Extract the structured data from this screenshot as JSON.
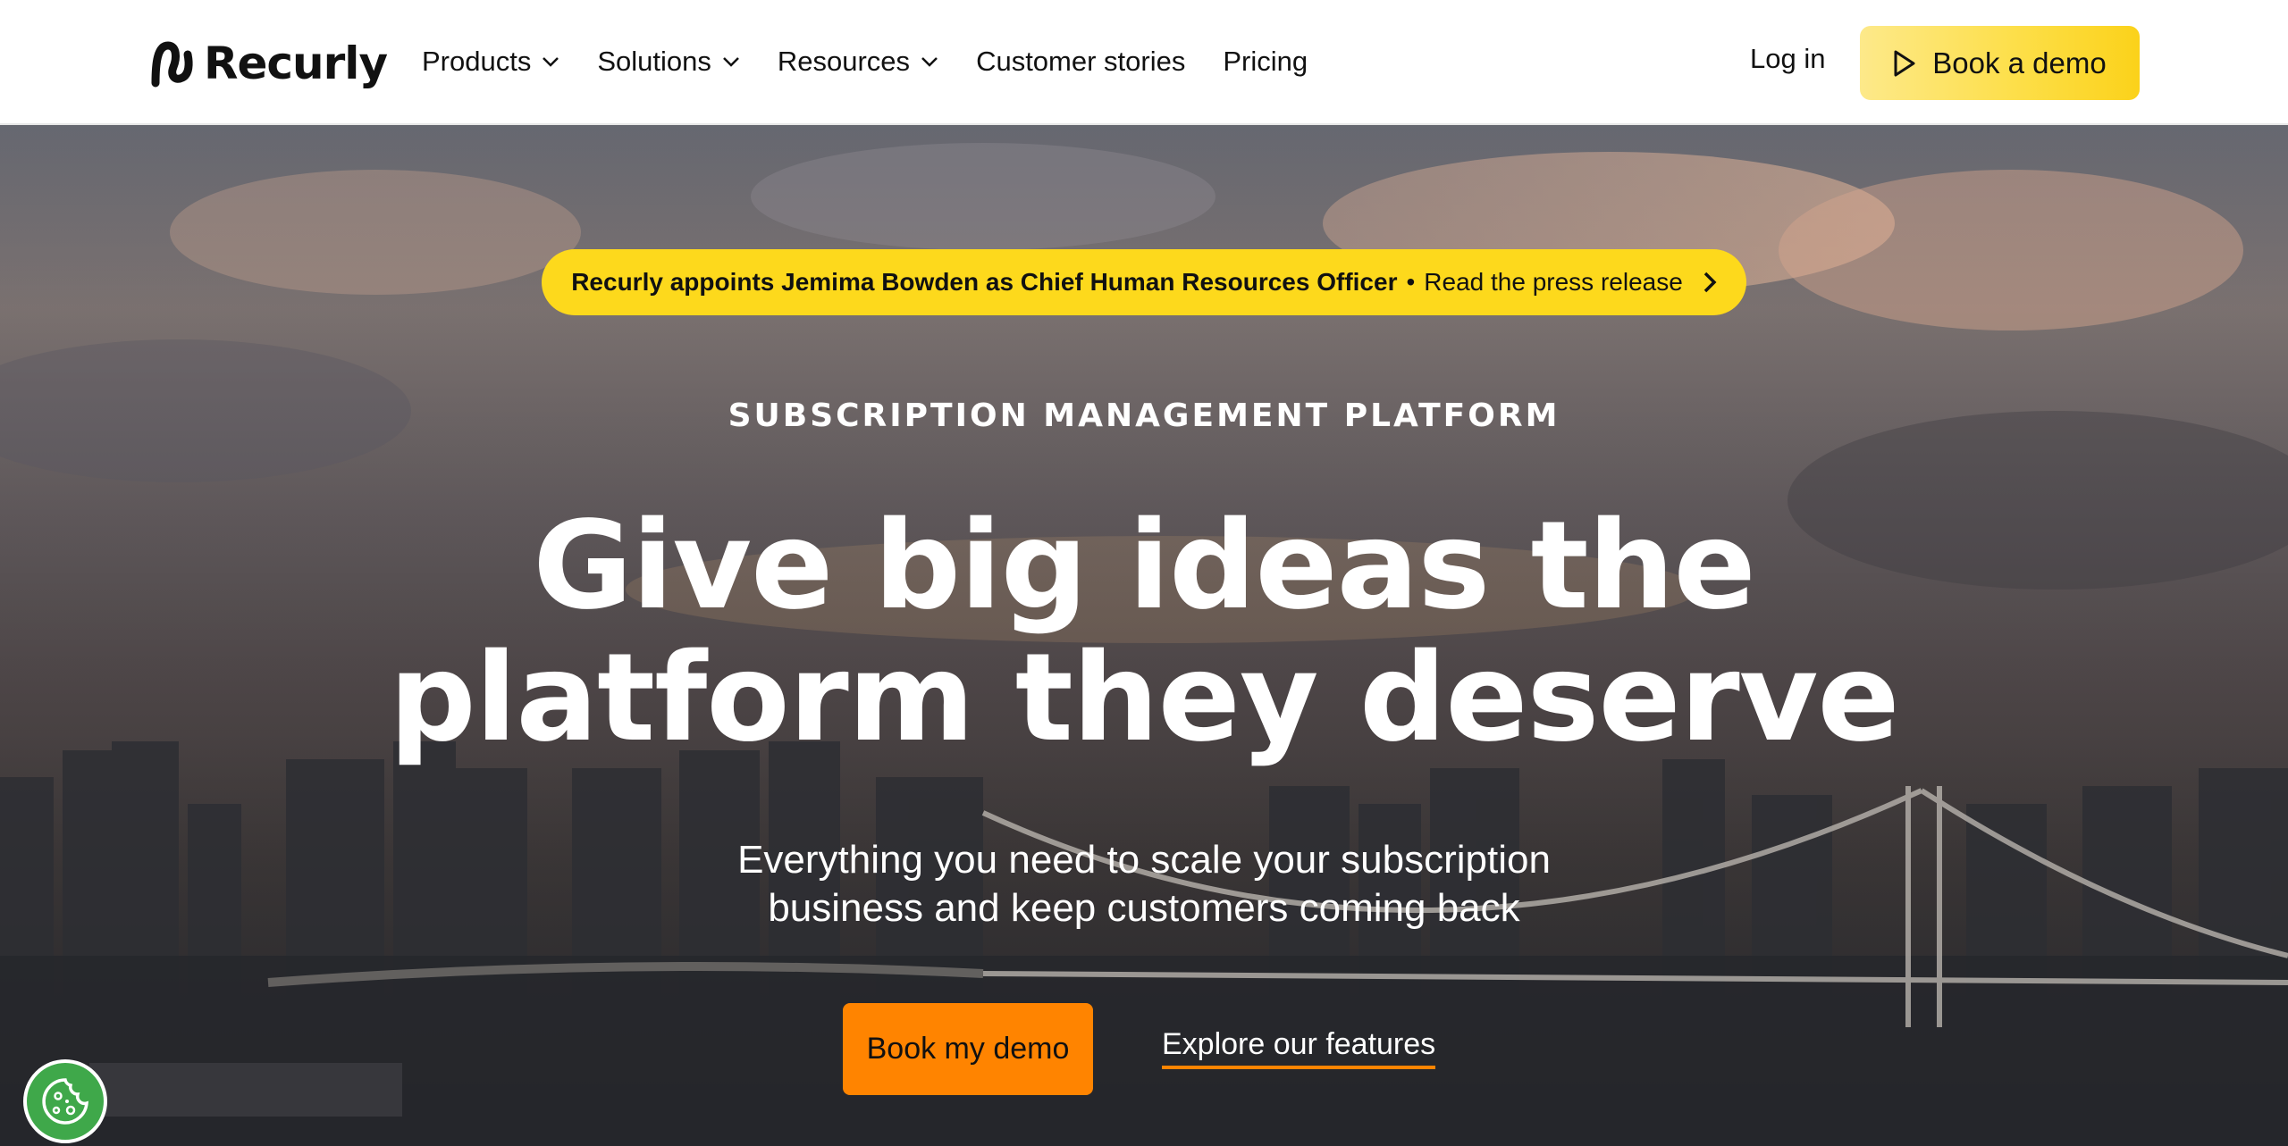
{
  "brand": {
    "name": "Recurly"
  },
  "nav": {
    "items": [
      {
        "label": "Products",
        "has_dropdown": true
      },
      {
        "label": "Solutions",
        "has_dropdown": true
      },
      {
        "label": "Resources",
        "has_dropdown": true
      },
      {
        "label": "Customer stories",
        "has_dropdown": false
      },
      {
        "label": "Pricing",
        "has_dropdown": false
      }
    ],
    "login_label": "Log in",
    "demo_label": "Book a demo"
  },
  "announcement": {
    "bold_text": "Recurly appoints Jemima Bowden as Chief Human Resources Officer",
    "separator": "•",
    "link_text": "Read the press release"
  },
  "hero": {
    "eyebrow": "SUBSCRIPTION MANAGEMENT PLATFORM",
    "headline_line1": "Give big ideas the",
    "headline_line2": "platform they deserve",
    "subhead_line1": "Everything you need to scale your subscription",
    "subhead_line2": "business and keep customers coming back",
    "primary_cta": "Book my demo",
    "secondary_cta": "Explore our features"
  },
  "colors": {
    "accent_yellow": "#fdd91c",
    "accent_orange": "#ff8400",
    "cookie_green": "#3fa84a"
  },
  "icons": [
    "recurly-logo-icon",
    "chevron-down-icon",
    "play-icon",
    "chevron-right-icon",
    "cookie-icon"
  ]
}
